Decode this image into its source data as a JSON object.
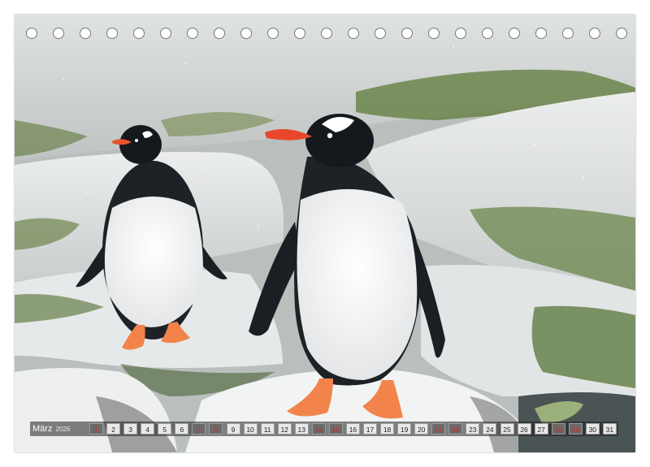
{
  "calendar": {
    "month": "März",
    "year": "2026",
    "days": [
      {
        "n": "1",
        "t": "we"
      },
      {
        "n": "2",
        "t": ""
      },
      {
        "n": "3",
        "t": ""
      },
      {
        "n": "4",
        "t": ""
      },
      {
        "n": "5",
        "t": ""
      },
      {
        "n": "6",
        "t": ""
      },
      {
        "n": "7",
        "t": "we"
      },
      {
        "n": "8",
        "t": "we"
      },
      {
        "n": "9",
        "t": ""
      },
      {
        "n": "10",
        "t": ""
      },
      {
        "n": "11",
        "t": ""
      },
      {
        "n": "12",
        "t": ""
      },
      {
        "n": "13",
        "t": ""
      },
      {
        "n": "14",
        "t": "we"
      },
      {
        "n": "15",
        "t": "we"
      },
      {
        "n": "16",
        "t": ""
      },
      {
        "n": "17",
        "t": ""
      },
      {
        "n": "18",
        "t": ""
      },
      {
        "n": "19",
        "t": ""
      },
      {
        "n": "20",
        "t": ""
      },
      {
        "n": "21",
        "t": "we"
      },
      {
        "n": "22",
        "t": "we"
      },
      {
        "n": "23",
        "t": ""
      },
      {
        "n": "24",
        "t": ""
      },
      {
        "n": "25",
        "t": ""
      },
      {
        "n": "26",
        "t": ""
      },
      {
        "n": "27",
        "t": ""
      },
      {
        "n": "28",
        "t": "we"
      },
      {
        "n": "29",
        "t": "we"
      },
      {
        "n": "30",
        "t": ""
      },
      {
        "n": "31",
        "t": ""
      }
    ]
  },
  "binding_holes": 23,
  "colors": {
    "weekend_text": "#d42a2a",
    "day_cell_bg": "#e8e8e8",
    "bar_bg": "#1e1e1e"
  }
}
